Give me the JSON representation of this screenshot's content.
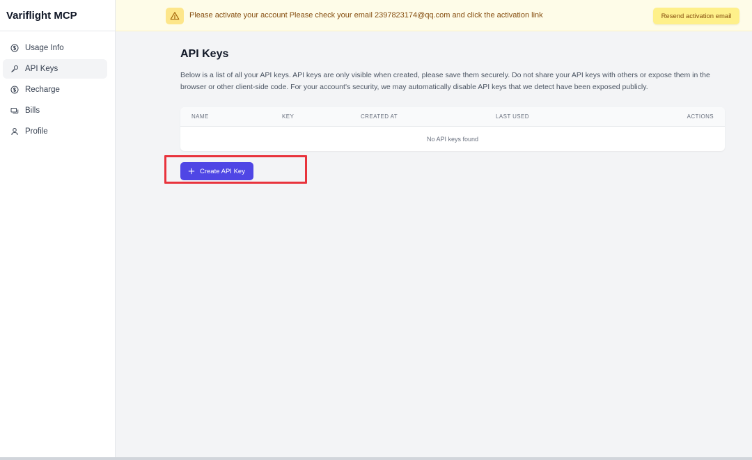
{
  "app": {
    "title": "Variflight MCP"
  },
  "sidebar": {
    "items": [
      {
        "label": "Usage Info",
        "icon": "dollar-circle-icon"
      },
      {
        "label": "API Keys",
        "icon": "key-icon",
        "active": true
      },
      {
        "label": "Recharge",
        "icon": "dollar-circle-icon"
      },
      {
        "label": "Bills",
        "icon": "cards-icon"
      },
      {
        "label": "Profile",
        "icon": "user-icon"
      }
    ]
  },
  "banner": {
    "icon": "warning-triangle-icon",
    "message": "Please activate your account Please check your email 2397823174@qq.com and click the activation link",
    "resend_label": "Resend activation email"
  },
  "main": {
    "title": "API Keys",
    "description": "Below is a list of all your API keys. API keys are only visible when created, please save them securely. Do not share your API keys with others or expose them in the browser or other client-side code. For your account's security, we may automatically disable API keys that we detect have been exposed publicly.",
    "table": {
      "headers": [
        "NAME",
        "KEY",
        "CREATED AT",
        "LAST USED",
        "ACTIONS"
      ],
      "empty_text": "No API keys found"
    },
    "create_button_label": "Create API Key"
  },
  "colors": {
    "accent": "#4f46e5",
    "highlight_box": "#e8333c",
    "banner_bg": "#fefce8",
    "banner_text": "#854d0e"
  }
}
